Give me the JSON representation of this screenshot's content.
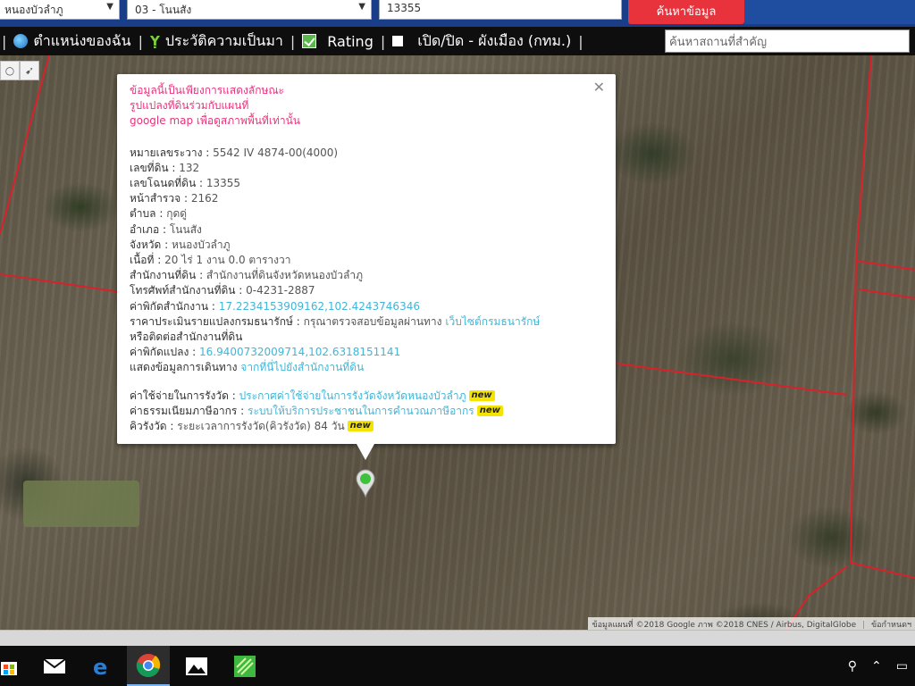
{
  "search": {
    "province_select": "หนองบัวลำภู",
    "district_select": "03 - โนนสัง",
    "deed_input": "13355",
    "search_button": "ค้นหาข้อมูล"
  },
  "menu": {
    "my_location": "ตำแหน่งของฉัน",
    "history": "ประวัติความเป็นมา",
    "rating": "Rating",
    "city_plan": "เปิด/ปิด - ผังเมือง (กทม.)",
    "place_placeholder": "ค้นหาสถานที่สำคัญ"
  },
  "popup": {
    "disclaimer": [
      "ข้อมูลนี้เป็นเพียงการแสดงลักษณะ",
      "รูปแปลงที่ดินร่วมกับแผนที่",
      "google map เพื่อดูสภาพพื้นที่เท่านั้น"
    ],
    "fields": [
      {
        "label": "หมายเลขระวาง",
        "value": "5542 IV 4874-00(4000)"
      },
      {
        "label": "เลขที่ดิน",
        "value": "132"
      },
      {
        "label": "เลขโฉนดที่ดิน",
        "value": "13355"
      },
      {
        "label": "หน้าสำรวจ",
        "value": "2162"
      },
      {
        "label": "ตำบล",
        "value": "กุดดู่"
      },
      {
        "label": "อำเภอ",
        "value": "โนนสัง"
      },
      {
        "label": "จังหวัด",
        "value": "หนองบัวลำภู"
      },
      {
        "label": "เนื้อที่",
        "value": "20 ไร่ 1 งาน 0.0 ตารางวา"
      },
      {
        "label": "สำนักงานที่ดิน",
        "value": "สำนักงานที่ดินจังหวัดหนองบัวลำภู"
      },
      {
        "label": "โทรศัพท์สำนักงานที่ดิน",
        "value": "0-4231-2887"
      }
    ],
    "office_coord_label": "ค่าพิกัดสำนักงาน",
    "office_coord": "17.2234153909162,102.4243746346",
    "appraisal_label": "ราคาประเมินรายแปลงกรมธนารักษ์",
    "appraisal_text": "กรุณาตรวจสอบข้อมูลผ่านทาง",
    "appraisal_link": "เว็บไซต์กรมธนารักษ์",
    "appraisal_line2": "หรือติดต่อสำนักงานที่ดิน",
    "parcel_coord_label": "ค่าพิกัดแปลง",
    "parcel_coord": "16.9400732009714,102.6318151141",
    "route_label": "แสดงข้อมูลการเดินทาง",
    "route_link": "จากที่นี่ไปยังสำนักงานที่ดิน",
    "fee_label": "ค่าใช้จ่ายในการรังวัด",
    "fee_link": "ประกาศค่าใช้จ่ายในการรังวัดจังหวัดหนองบัวลำภู",
    "tax_label": "ค่าธรรมเนียมภาษีอากร",
    "tax_link": "ระบบให้บริการประชาชนในการคำนวณภาษีอากร",
    "queue_label": "คิวรังวัด",
    "queue_value": "ระยะเวลาการรังวัด(คิวรังวัด) 84 วัน",
    "new_badge": "new"
  },
  "attribution": {
    "text": "ข้อมูลแผนที่ ©2018 Google ภาพ ©2018 CNES / Airbus, DigitalGlobe",
    "terms": "ข้อกำหนดฯ"
  }
}
